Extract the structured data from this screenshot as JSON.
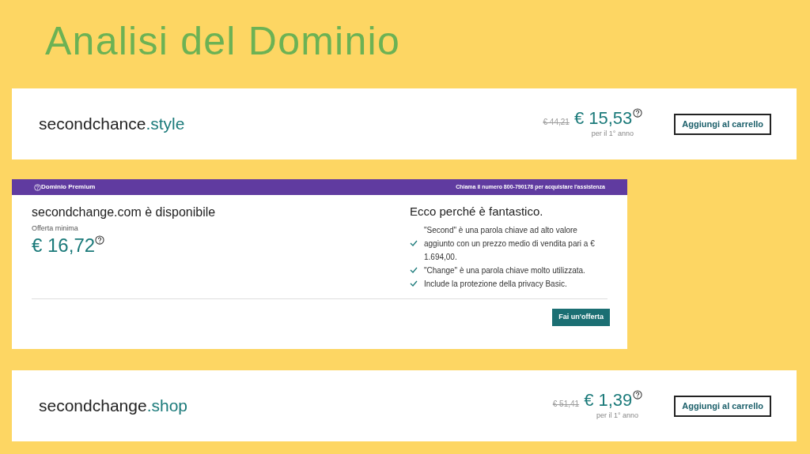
{
  "title": "Analisi del Dominio",
  "offers": [
    {
      "kind": "listing",
      "name": "secondchance",
      "tld": ".style",
      "old_price": "€ 44,21",
      "price": "€ 15,53",
      "period": "per il 1° anno",
      "button": "Aggiungi al carrello"
    },
    {
      "kind": "premium",
      "badge": "Dominio Premium",
      "phone_note": "Chiama il numero 800-790178 per acquistare l'assistenza",
      "headline": "secondchange.com è disponibile",
      "min_label": "Offerta minima",
      "price": "€ 16,72",
      "why_title": "Ecco perché è fantastico.",
      "reasons": [
        "\"Second\" è una parola chiave ad alto valore aggiunto con un prezzo medio di vendita pari a € 1.694,00.",
        "\"Change\" è una parola chiave molto utilizzata.",
        "Include la protezione della privacy Basic."
      ],
      "button": "Fai un'offerta"
    },
    {
      "kind": "listing",
      "name": "secondchange",
      "tld": ".shop",
      "old_price": "€ 51,41",
      "price": "€ 1,39",
      "period": "per il 1° anno",
      "button": "Aggiungi al carrello"
    }
  ]
}
